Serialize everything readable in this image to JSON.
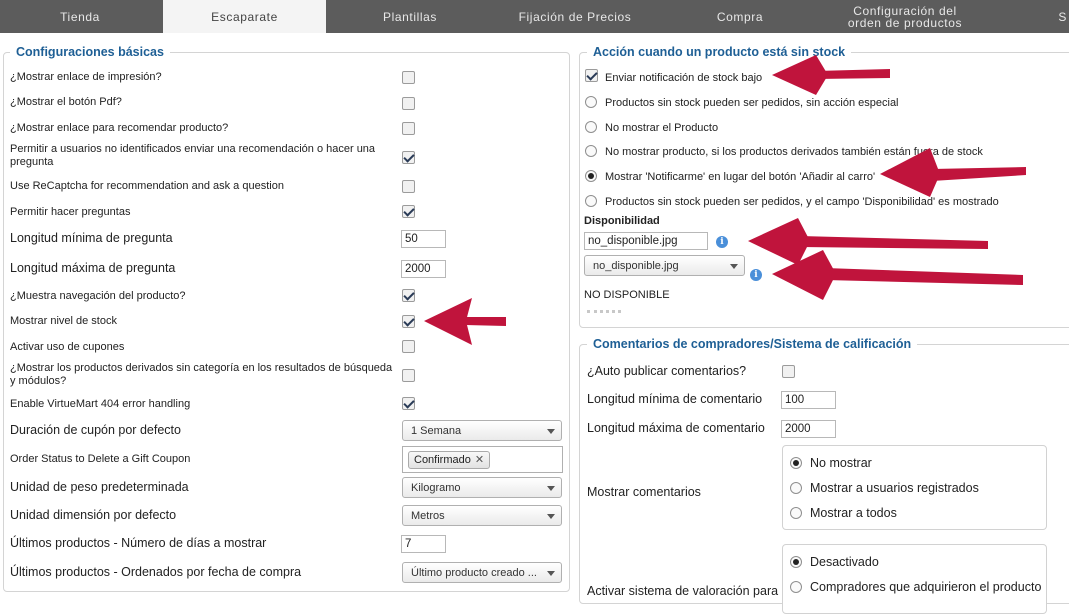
{
  "tabs": [
    {
      "label": "Tienda",
      "active": false
    },
    {
      "label": "Escaparate",
      "active": true
    },
    {
      "label": "Plantillas",
      "active": false
    },
    {
      "label": "Fijación de Precios",
      "active": false
    },
    {
      "label": "Compra",
      "active": false
    },
    {
      "label": "Configuración del orden de productos",
      "active": false
    },
    {
      "label": "S",
      "active": false
    }
  ],
  "basic": {
    "legend": "Configuraciones básicas",
    "rows": [
      {
        "label": "¿Mostrar enlace de impresión?",
        "type": "checkbox",
        "checked": false
      },
      {
        "label": "¿Mostrar el botón Pdf?",
        "type": "checkbox",
        "checked": false
      },
      {
        "label": "¿Mostrar enlace para recomendar producto?",
        "type": "checkbox",
        "checked": false
      },
      {
        "label": "Permitir a usuarios no identificados enviar una recomendación o hacer una pregunta",
        "type": "checkbox",
        "checked": true
      },
      {
        "label": "Use ReCaptcha for recommendation and ask a question",
        "type": "checkbox",
        "checked": false
      },
      {
        "label": "Permitir hacer preguntas",
        "type": "checkbox",
        "checked": true
      },
      {
        "label": "Longitud mínima de pregunta",
        "type": "text",
        "value": "50"
      },
      {
        "label": "Longitud máxima de pregunta",
        "type": "text",
        "value": "2000"
      },
      {
        "label": "¿Muestra navegación del producto?",
        "type": "checkbox",
        "checked": true
      },
      {
        "label": "Mostrar nivel de stock",
        "type": "checkbox",
        "checked": true
      },
      {
        "label": "Activar uso de cupones",
        "type": "checkbox",
        "checked": false
      },
      {
        "label": "¿Mostrar los productos derivados sin categoría en los resultados de búsqueda y módulos?",
        "type": "checkbox",
        "checked": false
      },
      {
        "label": "Enable VirtueMart 404 error handling",
        "type": "checkbox",
        "checked": true
      },
      {
        "label": "Duración de cupón por defecto",
        "type": "select",
        "value": "1 Semana"
      },
      {
        "label": "Order Status to Delete a Gift Coupon",
        "type": "chips",
        "value": "Confirmado"
      },
      {
        "label": "Unidad de peso predeterminada",
        "type": "select",
        "value": "Kilogramo"
      },
      {
        "label": "Unidad dimensión por defecto",
        "type": "select",
        "value": "Metros"
      },
      {
        "label": "Últimos productos - Número de días a mostrar",
        "type": "text",
        "value": "7"
      },
      {
        "label": "Últimos productos - Ordenados por fecha de compra",
        "type": "select",
        "value": "Último producto creado ..."
      }
    ]
  },
  "stock": {
    "legend": "Acción cuando un producto está sin stock",
    "notify_label": "Enviar notificación de stock bajo",
    "notify_checked": true,
    "options": [
      {
        "label": "Productos sin stock pueden ser pedidos, sin acción especial",
        "selected": false
      },
      {
        "label": "No mostrar el Producto",
        "selected": false
      },
      {
        "label": "No mostrar producto, si los productos derivados también están fuera de stock",
        "selected": false
      },
      {
        "label": "Mostrar 'Notificarme' en lugar del botón 'Añadir al carro'",
        "selected": true
      },
      {
        "label": "Productos sin stock pueden ser pedidos, y el campo 'Disponibilidad' es mostrado",
        "selected": false
      }
    ],
    "availability_label": "Disponibilidad",
    "availability_value": "no_disponible.jpg",
    "availability_select": "no_disponible.jpg",
    "availability_text": "NO DISPONIBLE",
    "info_glyph": "i"
  },
  "reviews": {
    "legend": "Comentarios de compradores/Sistema de calificación",
    "auto_publish_label": "¿Auto publicar comentarios?",
    "auto_publish_checked": false,
    "min_label": "Longitud mínima de comentario",
    "min_value": "100",
    "max_label": "Longitud máxima de comentario",
    "max_value": "2000",
    "show_label": "Mostrar comentarios",
    "show_options": [
      {
        "label": "No mostrar",
        "selected": true
      },
      {
        "label": "Mostrar a usuarios registrados",
        "selected": false
      },
      {
        "label": "Mostrar a todos",
        "selected": false
      }
    ],
    "rating_label": "Activar sistema de valoración para",
    "rating_options": [
      {
        "label": "Desactivado",
        "selected": true
      },
      {
        "label": "Compradores que adquirieron el producto",
        "selected": false
      }
    ]
  },
  "colors": {
    "tabbar": "#5c5c5c",
    "legend": "#1e5f95",
    "annotation_arrow": "#c0143c"
  }
}
